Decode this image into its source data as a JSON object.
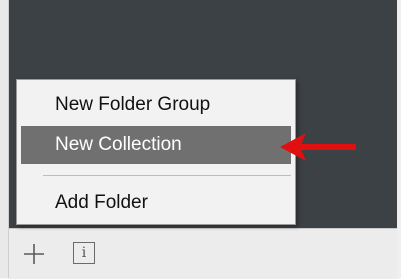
{
  "menu": {
    "items": [
      {
        "label": "New Folder Group"
      },
      {
        "label": "New Collection",
        "highlighted": true
      },
      {
        "label": "Add Folder"
      }
    ]
  },
  "toolbar": {
    "add_icon": "plus-icon",
    "info_icon": "info-icon",
    "info_glyph": "i"
  },
  "annotation": {
    "arrow_color": "#e01010"
  },
  "colors": {
    "panel_bg": "#3c4146",
    "menu_bg": "#f2f2f2",
    "highlight_bg": "#707070"
  }
}
